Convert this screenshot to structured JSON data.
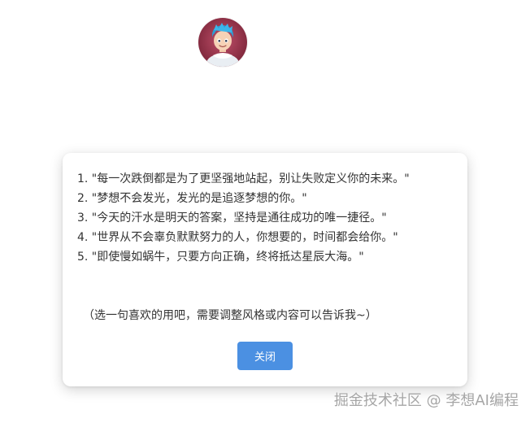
{
  "avatar": {
    "alt": "avatar"
  },
  "modal": {
    "quotes": [
      "1. \"每一次跌倒都是为了更坚强地站起，别让失败定义你的未来。\"",
      "2. \"梦想不会发光，发光的是追逐梦想的你。\"",
      "3. \"今天的汗水是明天的答案，坚持是通往成功的唯一捷径。\"",
      "4. \"世界从不会辜负默默努力的人，你想要的，时间都会给你。\"",
      "5. \"即使慢如蜗牛，只要方向正确，终将抵达星辰大海。\""
    ],
    "note": "（选一句喜欢的用吧，需要调整风格或内容可以告诉我~）",
    "close_label": "关闭"
  },
  "watermark": {
    "text": "掘金技术社区 @ 李想AI编程"
  },
  "colors": {
    "button": "#4b90e2",
    "background": "#ffffff",
    "text": "#333333"
  }
}
